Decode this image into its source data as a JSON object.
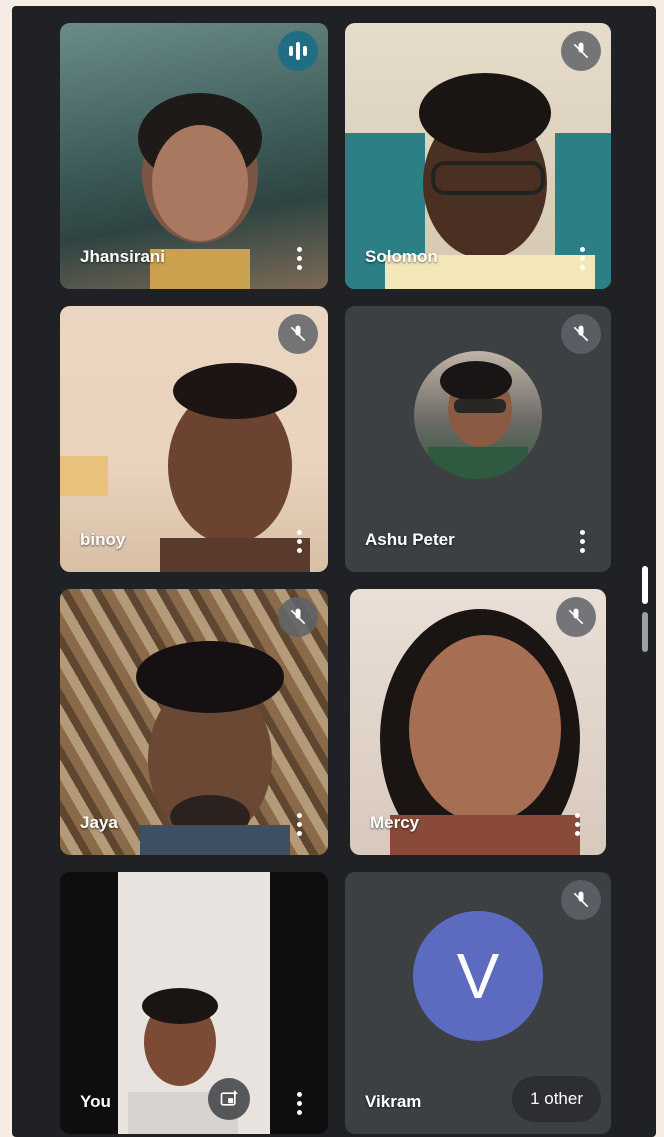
{
  "participants": [
    {
      "name": "Jhansirani",
      "state": "speaking"
    },
    {
      "name": "Solomon",
      "state": "muted"
    },
    {
      "name": "binoy",
      "state": "muted"
    },
    {
      "name": "Ashu Peter",
      "state": "muted"
    },
    {
      "name": "Jaya",
      "state": "muted"
    },
    {
      "name": "Mercy",
      "state": "muted"
    },
    {
      "name": "You",
      "state": "self"
    },
    {
      "name": "Vikram",
      "state": "muted",
      "avatar_letter": "V"
    }
  ],
  "others_label": "1 other",
  "colors": {
    "background": "#202124",
    "tile": "#3c4043",
    "active_border": "#1e6273",
    "avatar_v": "#5c6bc0"
  },
  "icons": {
    "muted": "mic-off-icon",
    "speaking": "audio-level-icon",
    "menu": "more-vert-icon",
    "pip": "picture-in-picture-icon"
  }
}
